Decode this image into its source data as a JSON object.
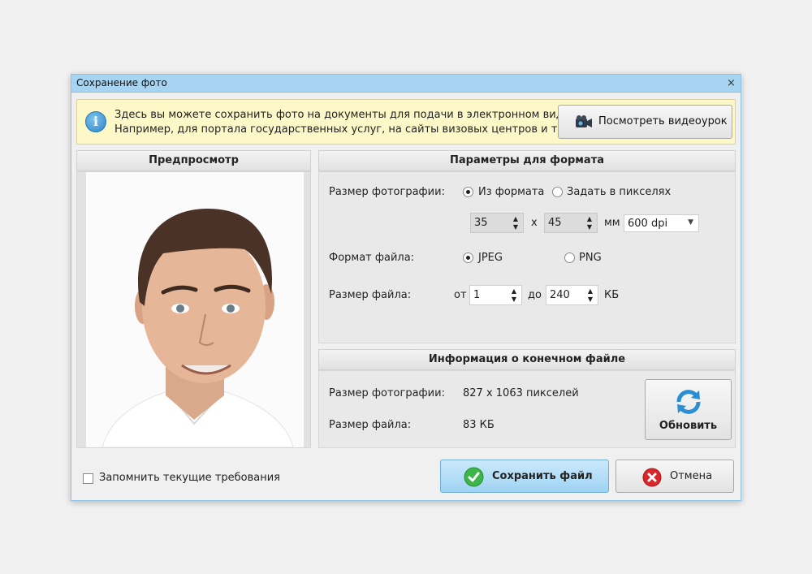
{
  "window": {
    "title": "Сохранение фото",
    "close_glyph": "×"
  },
  "info": {
    "icon": "info-icon",
    "icon_glyph": "i",
    "line1": "Здесь вы можете сохранить фото на документы для подачи в электронном виде.",
    "line2": "Например, для портала государственных услуг, на сайты визовых центров и т.п.",
    "video_button_label": "Посмотреть видеоурок"
  },
  "preview": {
    "header": "Предпросмотр"
  },
  "format_params": {
    "header": "Параметры для формата",
    "photo_size_label": "Размер фотографии:",
    "option_from_format": "Из формата",
    "option_pixels": "Задать в пикселях",
    "selected_size_option": "Из формата",
    "width_value": "35",
    "times_sign": "x",
    "height_value": "45",
    "unit_mm": "мм",
    "dpi_value": "600 dpi",
    "file_format_label": "Формат файла:",
    "option_jpeg": "JPEG",
    "option_png": "PNG",
    "selected_format": "JPEG",
    "file_size_label": "Размер файла:",
    "from_label": "от",
    "min_size": "1",
    "to_label": "до",
    "max_size": "240",
    "unit_kb": "КБ"
  },
  "result_info": {
    "header": "Информация о конечном файле",
    "photo_size_label": "Размер фотографии:",
    "photo_size_value": "827 x 1063 пикселей",
    "file_size_label": "Размер файла:",
    "file_size_value": "83 КБ",
    "refresh_label": "Обновить"
  },
  "footer": {
    "remember_label": "Запомнить текущие требования",
    "remember_checked": false,
    "save_label": "Сохранить файл",
    "cancel_label": "Отмена"
  },
  "colors": {
    "titlebar": "#a7d4f0",
    "info_bg": "#fdf8c8",
    "save_button": "#a8d8f5",
    "refresh_icon": "#2b8fd6",
    "save_icon": "#3cb54a",
    "cancel_icon": "#d9262b"
  }
}
